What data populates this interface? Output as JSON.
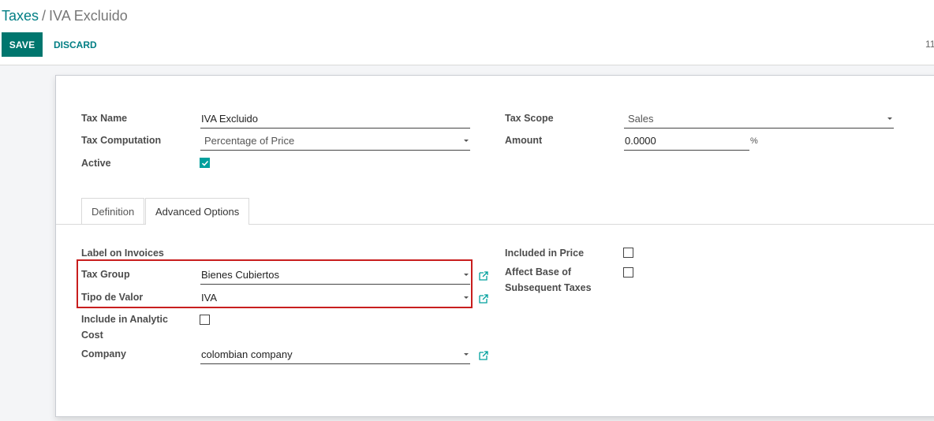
{
  "breadcrumb": {
    "parent": "Taxes",
    "separator": "/",
    "current": "IVA Excluido"
  },
  "actions": {
    "save": "SAVE",
    "discard": "DISCARD"
  },
  "pager": {
    "text": "11"
  },
  "form": {
    "tax_name_label": "Tax Name",
    "tax_name_value": "IVA Excluido",
    "tax_computation_label": "Tax Computation",
    "tax_computation_value": "Percentage of Price",
    "active_label": "Active",
    "active_checked": true,
    "tax_scope_label": "Tax Scope",
    "tax_scope_value": "Sales",
    "amount_label": "Amount",
    "amount_value": "0.0000",
    "amount_unit": "%"
  },
  "tabs": [
    {
      "label": "Definition",
      "active": false
    },
    {
      "label": "Advanced Options",
      "active": true
    }
  ],
  "advanced": {
    "label_on_invoices_label": "Label on Invoices",
    "tax_group_label": "Tax Group",
    "tax_group_value": "Bienes Cubiertos",
    "tipo_valor_label": "Tipo de Valor",
    "tipo_valor_value": "IVA",
    "include_analytic_label_1": "Include in Analytic",
    "include_analytic_label_2": "Cost",
    "include_analytic_checked": false,
    "company_label": "Company",
    "company_value": "colombian company",
    "included_price_label": "Included in Price",
    "included_price_checked": false,
    "affect_base_label_1": "Affect Base of",
    "affect_base_label_2": "Subsequent Taxes",
    "affect_base_checked": false
  },
  "colors": {
    "brand": "#00766e",
    "link": "#017e84",
    "check": "#00a09d",
    "highlight": "#c81e1e"
  }
}
